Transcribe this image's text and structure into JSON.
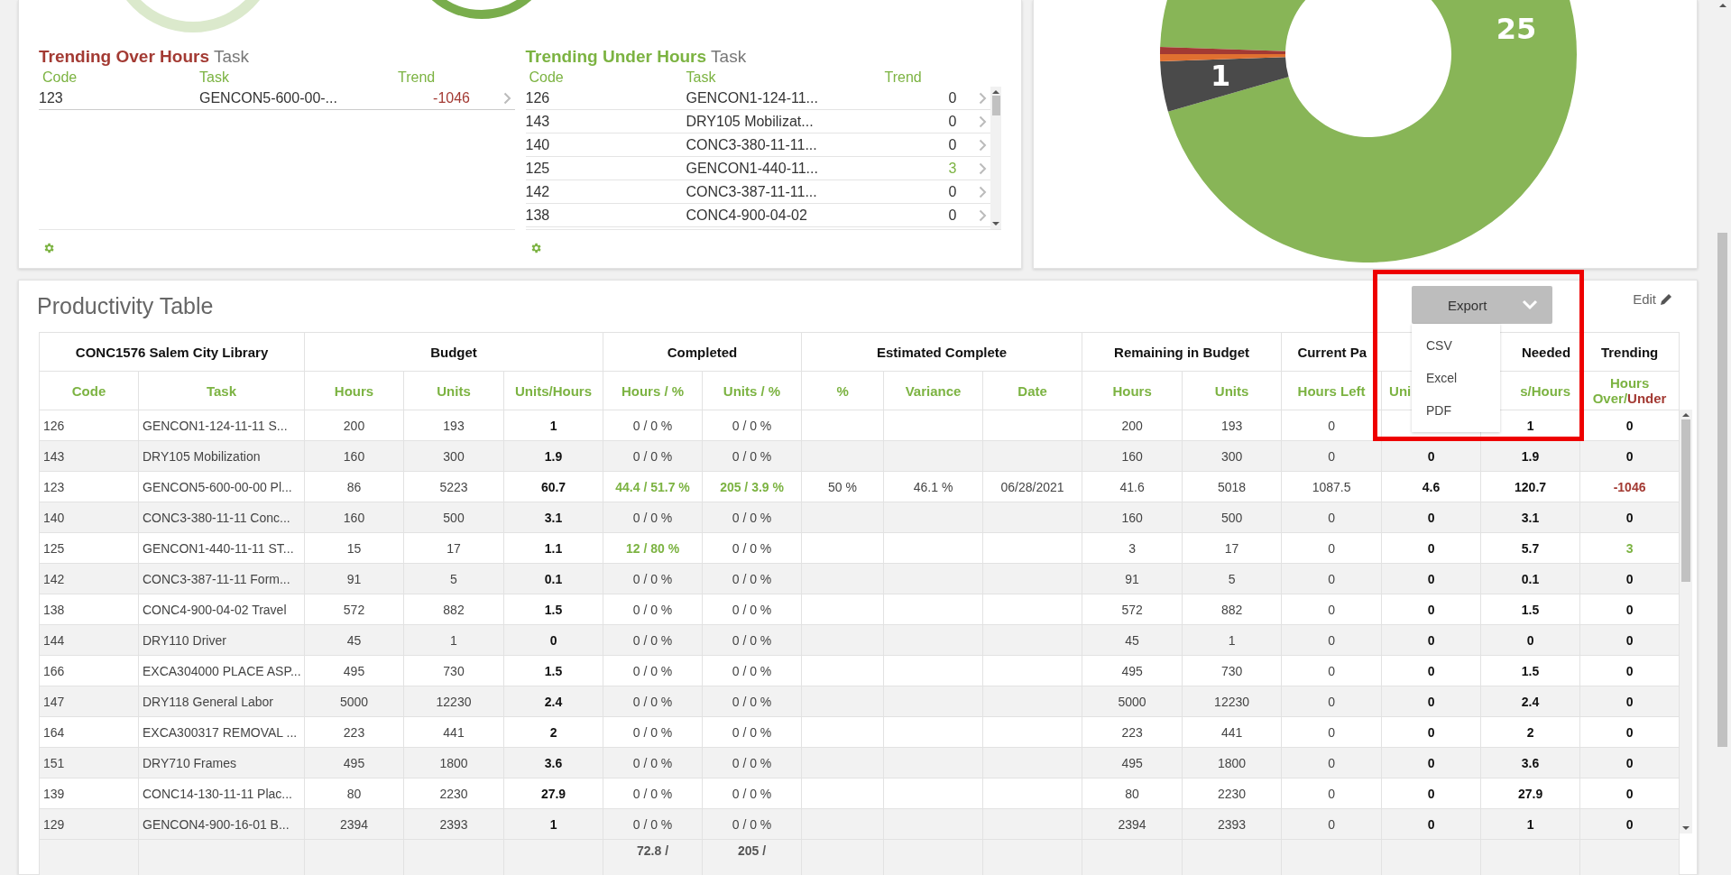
{
  "trending_over": {
    "title": "Trending Over Hours",
    "title_suffix": "Task",
    "columns": [
      "Code",
      "Task",
      "Trend"
    ],
    "rows": [
      {
        "code": "123",
        "task": "GENCON5-600-00-...",
        "trend": "-1046",
        "color": "#a33a33"
      }
    ]
  },
  "trending_under": {
    "title": "Trending Under Hours",
    "title_suffix": "Task",
    "columns": [
      "Code",
      "Task",
      "Trend"
    ],
    "rows": [
      {
        "code": "126",
        "task": "GENCON1-124-11...",
        "trend": "0",
        "color": "#333333"
      },
      {
        "code": "143",
        "task": "DRY105 Mobilizat...",
        "trend": "0",
        "color": "#333333"
      },
      {
        "code": "140",
        "task": "CONC3-380-11-11...",
        "trend": "0",
        "color": "#333333"
      },
      {
        "code": "125",
        "task": "GENCON1-440-11...",
        "trend": "3",
        "color": "#7cb342"
      },
      {
        "code": "142",
        "task": "CONC3-387-11-11...",
        "trend": "0",
        "color": "#333333"
      },
      {
        "code": "138",
        "task": "CONC4-900-04-02",
        "trend": "0",
        "color": "#333333"
      }
    ]
  },
  "donut": {
    "slice_labels": [
      "25",
      "1"
    ]
  },
  "productivity": {
    "title": "Productivity Table",
    "export_button": "Export",
    "export_menu": [
      "CSV",
      "Excel",
      "PDF"
    ],
    "edit_link": "Edit",
    "group_headers": [
      "CONC1576 Salem City Library",
      "Budget",
      "Completed",
      "Estimated Complete",
      "Remaining in Budget",
      "Current Pa",
      "Needed",
      "Trending"
    ],
    "columns": [
      {
        "label": "Code"
      },
      {
        "label": "Task"
      },
      {
        "label": "Hours"
      },
      {
        "label": "Units"
      },
      {
        "label": "Units/Hours"
      },
      {
        "label": "Hours / %"
      },
      {
        "label": "Units / %"
      },
      {
        "label": "%"
      },
      {
        "label": "Variance"
      },
      {
        "label": "Date"
      },
      {
        "label": "Hours"
      },
      {
        "label": "Units"
      },
      {
        "label": "Hours Left"
      },
      {
        "label": "Uni"
      },
      {
        "label": "s/Hours"
      },
      {
        "label": "Hours Over/",
        "label_negative": "Under"
      }
    ],
    "rows": [
      {
        "code": "126",
        "task": "GENCON1-124-11-11 S...",
        "budget_hours": "200",
        "budget_units": "193",
        "budget_rate": "1",
        "completed_hours": "0 / 0 %",
        "completed_units": "0 / 0 %",
        "remaining_hours": "200",
        "remaining_units": "193",
        "hours_left": "0",
        "needed": "1",
        "trending": "0",
        "hours_done": false,
        "units_done": false,
        "color": "#111111"
      },
      {
        "code": "143",
        "task": "DRY105 Mobilization",
        "budget_hours": "160",
        "budget_units": "300",
        "budget_rate": "1.9",
        "completed_hours": "0 / 0 %",
        "completed_units": "0 / 0 %",
        "remaining_hours": "160",
        "remaining_units": "300",
        "hours_left": "0",
        "pace_units": "0",
        "needed": "1.9",
        "trending": "0",
        "hours_done": false,
        "units_done": false,
        "color": "#111111"
      },
      {
        "code": "123",
        "task": "GENCON5-600-00-00 Pl...",
        "budget_hours": "86",
        "budget_units": "5223",
        "budget_rate": "60.7",
        "completed_hours": "44.4 / 51.7 %",
        "completed_units": "205 / 3.9 %",
        "est_pct": "50 %",
        "est_variance": "46.1 %",
        "est_date": "06/28/2021",
        "remaining_hours": "41.6",
        "remaining_units": "5018",
        "hours_left": "1087.5",
        "pace_units": "4.6",
        "needed": "120.7",
        "trending": "-1046",
        "hours_done": true,
        "units_done": true,
        "color": "#a33a33"
      },
      {
        "code": "140",
        "task": "CONC3-380-11-11 Conc...",
        "budget_hours": "160",
        "budget_units": "500",
        "budget_rate": "3.1",
        "completed_hours": "0 / 0 %",
        "completed_units": "0 / 0 %",
        "remaining_hours": "160",
        "remaining_units": "500",
        "hours_left": "0",
        "pace_units": "0",
        "needed": "3.1",
        "trending": "0",
        "hours_done": false,
        "units_done": false,
        "color": "#111111"
      },
      {
        "code": "125",
        "task": "GENCON1-440-11-11 ST...",
        "budget_hours": "15",
        "budget_units": "17",
        "budget_rate": "1.1",
        "completed_hours": "12 / 80 %",
        "completed_units": "0 / 0 %",
        "remaining_hours": "3",
        "remaining_units": "17",
        "hours_left": "0",
        "pace_units": "0",
        "needed": "5.7",
        "trending": "3",
        "hours_done": true,
        "units_done": false,
        "color": "#7cb342"
      },
      {
        "code": "142",
        "task": "CONC3-387-11-11 Form...",
        "budget_hours": "91",
        "budget_units": "5",
        "budget_rate": "0.1",
        "completed_hours": "0 / 0 %",
        "completed_units": "0 / 0 %",
        "remaining_hours": "91",
        "remaining_units": "5",
        "hours_left": "0",
        "pace_units": "0",
        "needed": "0.1",
        "trending": "0",
        "hours_done": false,
        "units_done": false,
        "color": "#111111"
      },
      {
        "code": "138",
        "task": "CONC4-900-04-02 Travel",
        "budget_hours": "572",
        "budget_units": "882",
        "budget_rate": "1.5",
        "completed_hours": "0 / 0 %",
        "completed_units": "0 / 0 %",
        "remaining_hours": "572",
        "remaining_units": "882",
        "hours_left": "0",
        "pace_units": "0",
        "needed": "1.5",
        "trending": "0",
        "hours_done": false,
        "units_done": false,
        "color": "#111111"
      },
      {
        "code": "144",
        "task": "DRY110 Driver",
        "budget_hours": "45",
        "budget_units": "1",
        "budget_rate": "0",
        "completed_hours": "0 / 0 %",
        "completed_units": "0 / 0 %",
        "remaining_hours": "45",
        "remaining_units": "1",
        "hours_left": "0",
        "pace_units": "0",
        "needed": "0",
        "trending": "0",
        "hours_done": false,
        "units_done": false,
        "color": "#111111"
      },
      {
        "code": "166",
        "task": "EXCA304000 PLACE ASP...",
        "budget_hours": "495",
        "budget_units": "730",
        "budget_rate": "1.5",
        "completed_hours": "0 / 0 %",
        "completed_units": "0 / 0 %",
        "remaining_hours": "495",
        "remaining_units": "730",
        "hours_left": "0",
        "pace_units": "0",
        "needed": "1.5",
        "trending": "0",
        "hours_done": false,
        "units_done": false,
        "color": "#111111"
      },
      {
        "code": "147",
        "task": "DRY118 General Labor",
        "budget_hours": "5000",
        "budget_units": "12230",
        "budget_rate": "2.4",
        "completed_hours": "0 / 0 %",
        "completed_units": "0 / 0 %",
        "remaining_hours": "5000",
        "remaining_units": "12230",
        "hours_left": "0",
        "pace_units": "0",
        "needed": "2.4",
        "trending": "0",
        "hours_done": false,
        "units_done": false,
        "color": "#111111"
      },
      {
        "code": "164",
        "task": "EXCA300317 REMOVAL ...",
        "budget_hours": "223",
        "budget_units": "441",
        "budget_rate": "2",
        "completed_hours": "0 / 0 %",
        "completed_units": "0 / 0 %",
        "remaining_hours": "223",
        "remaining_units": "441",
        "hours_left": "0",
        "pace_units": "0",
        "needed": "2",
        "trending": "0",
        "hours_done": false,
        "units_done": false,
        "color": "#111111"
      },
      {
        "code": "151",
        "task": "DRY710 Frames",
        "budget_hours": "495",
        "budget_units": "1800",
        "budget_rate": "3.6",
        "completed_hours": "0 / 0 %",
        "completed_units": "0 / 0 %",
        "remaining_hours": "495",
        "remaining_units": "1800",
        "hours_left": "0",
        "pace_units": "0",
        "needed": "3.6",
        "trending": "0",
        "hours_done": false,
        "units_done": false,
        "color": "#111111"
      },
      {
        "code": "139",
        "task": "CONC14-130-11-11 Plac...",
        "budget_hours": "80",
        "budget_units": "2230",
        "budget_rate": "27.9",
        "completed_hours": "0 / 0 %",
        "completed_units": "0 / 0 %",
        "remaining_hours": "80",
        "remaining_units": "2230",
        "hours_left": "0",
        "pace_units": "0",
        "needed": "27.9",
        "trending": "0",
        "hours_done": false,
        "units_done": false,
        "color": "#111111"
      },
      {
        "code": "129",
        "task": "GENCON4-900-16-01 B...",
        "budget_hours": "2394",
        "budget_units": "2393",
        "budget_rate": "1",
        "completed_hours": "0 / 0 %",
        "completed_units": "0 / 0 %",
        "remaining_hours": "2394",
        "remaining_units": "2393",
        "hours_left": "0",
        "pace_units": "0",
        "needed": "1",
        "trending": "0",
        "hours_done": false,
        "units_done": false,
        "color": "#111111"
      }
    ],
    "totals": {
      "completed_hours": "72.8 /",
      "completed_units": "205 /"
    }
  }
}
